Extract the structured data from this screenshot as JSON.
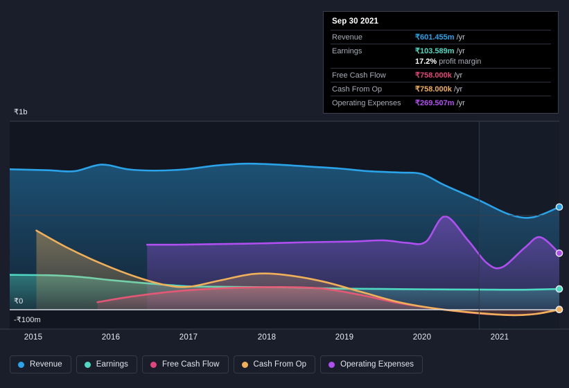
{
  "chart_data": {
    "type": "area",
    "title": "",
    "xlabel": "",
    "ylabel": "",
    "currency": "₹",
    "grid": true,
    "legend_position": "bottom",
    "x_ticks": [
      "2015",
      "2016",
      "2017",
      "2018",
      "2019",
      "2020",
      "2021"
    ],
    "y_ticks": [
      "₹1b",
      "₹0",
      "-₹100m"
    ],
    "ylim": [
      -100000000,
      1000000000
    ],
    "xlim": [
      2014.7,
      2021.9
    ],
    "forecast_start": "2020.85",
    "series": [
      {
        "name": "Revenue",
        "color": "#2aa3e8",
        "points": [
          [
            2014.7,
            745
          ],
          [
            2015.2,
            740
          ],
          [
            2015.55,
            735
          ],
          [
            2015.9,
            770
          ],
          [
            2016.25,
            745
          ],
          [
            2016.6,
            738
          ],
          [
            2017.0,
            745
          ],
          [
            2017.4,
            765
          ],
          [
            2017.8,
            775
          ],
          [
            2018.2,
            770
          ],
          [
            2018.6,
            760
          ],
          [
            2019.0,
            750
          ],
          [
            2019.4,
            735
          ],
          [
            2019.8,
            728
          ],
          [
            2020.1,
            720
          ],
          [
            2020.4,
            660
          ],
          [
            2020.85,
            580
          ],
          [
            2021.25,
            505
          ],
          [
            2021.55,
            490
          ],
          [
            2021.9,
            545
          ]
        ]
      },
      {
        "name": "Earnings",
        "color": "#4fd9c2",
        "points": [
          [
            2014.7,
            185
          ],
          [
            2015.2,
            183
          ],
          [
            2015.6,
            175
          ],
          [
            2016.0,
            158
          ],
          [
            2016.5,
            140
          ],
          [
            2017.0,
            125
          ],
          [
            2017.4,
            122
          ],
          [
            2017.9,
            120
          ],
          [
            2018.4,
            118
          ],
          [
            2019.0,
            112
          ],
          [
            2019.6,
            110
          ],
          [
            2020.2,
            108
          ],
          [
            2020.85,
            107
          ],
          [
            2021.4,
            106
          ],
          [
            2021.9,
            110
          ]
        ]
      },
      {
        "name": "Free Cash Flow",
        "color": "#e0457b",
        "points": [
          [
            2015.85,
            40
          ],
          [
            2016.3,
            70
          ],
          [
            2016.8,
            95
          ],
          [
            2017.3,
            110
          ],
          [
            2017.8,
            118
          ],
          [
            2018.3,
            120
          ],
          [
            2018.8,
            112
          ],
          [
            2019.3,
            78
          ],
          [
            2019.8,
            35
          ],
          [
            2020.3,
            5
          ],
          [
            2020.85,
            -20
          ],
          [
            2021.3,
            -28
          ],
          [
            2021.6,
            -22
          ],
          [
            2021.9,
            1
          ]
        ]
      },
      {
        "name": "Cash From Op",
        "color": "#f0b05a",
        "points": [
          [
            2015.05,
            420
          ],
          [
            2015.45,
            330
          ],
          [
            2015.9,
            245
          ],
          [
            2016.35,
            175
          ],
          [
            2016.75,
            130
          ],
          [
            2017.05,
            122
          ],
          [
            2017.45,
            155
          ],
          [
            2017.9,
            190
          ],
          [
            2018.3,
            185
          ],
          [
            2018.8,
            150
          ],
          [
            2019.3,
            95
          ],
          [
            2019.8,
            40
          ],
          [
            2020.3,
            5
          ],
          [
            2020.85,
            -18
          ],
          [
            2021.3,
            -29
          ],
          [
            2021.6,
            -22
          ],
          [
            2021.9,
            1
          ]
        ]
      },
      {
        "name": "Operating Expenses",
        "color": "#b04ff0",
        "points": [
          [
            2016.5,
            345
          ],
          [
            2016.9,
            345
          ],
          [
            2017.4,
            348
          ],
          [
            2018.0,
            352
          ],
          [
            2018.6,
            358
          ],
          [
            2019.2,
            362
          ],
          [
            2019.6,
            368
          ],
          [
            2019.9,
            355
          ],
          [
            2020.15,
            360
          ],
          [
            2020.4,
            495
          ],
          [
            2020.7,
            370
          ],
          [
            2020.95,
            248
          ],
          [
            2021.15,
            225
          ],
          [
            2021.45,
            330
          ],
          [
            2021.65,
            385
          ],
          [
            2021.9,
            300
          ]
        ]
      }
    ]
  },
  "axis": {
    "y_labels": [
      {
        "text": "₹1b",
        "pos": 155
      },
      {
        "text": "₹0",
        "pos": 428
      },
      {
        "text": "-₹100m",
        "pos": 455
      }
    ],
    "x_labels": [
      {
        "text": "2015",
        "pos": 48
      },
      {
        "text": "2016",
        "pos": 160
      },
      {
        "text": "2017",
        "pos": 272
      },
      {
        "text": "2018",
        "pos": 385
      },
      {
        "text": "2019",
        "pos": 497
      },
      {
        "text": "2020",
        "pos": 609
      },
      {
        "text": "2021",
        "pos": 721
      }
    ]
  },
  "tooltip": {
    "date": "Sep 30 2021",
    "rows": [
      {
        "label": "Revenue",
        "amount": "₹601.455m",
        "unit": "/yr",
        "color": "#2aa3e8"
      },
      {
        "label": "Earnings",
        "amount": "₹103.589m",
        "unit": "/yr",
        "color": "#4fd9c2"
      },
      {
        "label": "Free Cash Flow",
        "amount": "₹758.000k",
        "unit": "/yr",
        "color": "#e0457b"
      },
      {
        "label": "Cash From Op",
        "amount": "₹758.000k",
        "unit": "/yr",
        "color": "#f0b05a"
      },
      {
        "label": "Operating Expenses",
        "amount": "₹269.507m",
        "unit": "/yr",
        "color": "#b04ff0"
      }
    ],
    "margin_value": "17.2%",
    "margin_text": "profit margin"
  },
  "legend": {
    "items": [
      {
        "label": "Revenue",
        "color": "#2aa3e8"
      },
      {
        "label": "Earnings",
        "color": "#4fd9c2"
      },
      {
        "label": "Free Cash Flow",
        "color": "#e0457b"
      },
      {
        "label": "Cash From Op",
        "color": "#f0b05a"
      },
      {
        "label": "Operating Expenses",
        "color": "#b04ff0"
      }
    ]
  }
}
